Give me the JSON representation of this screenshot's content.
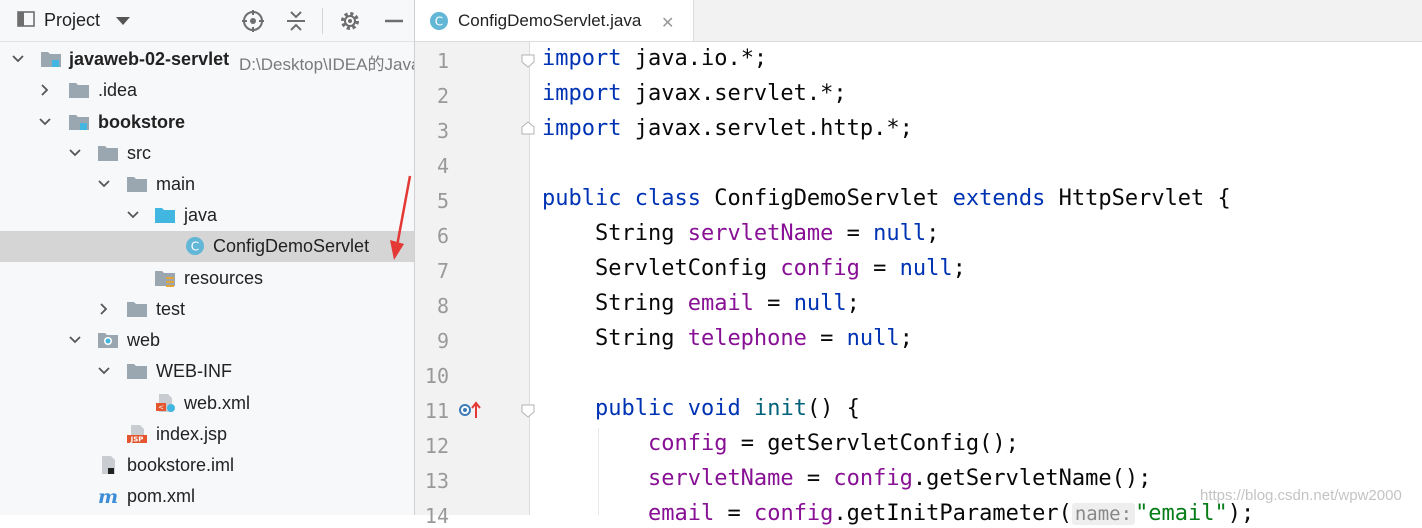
{
  "project_panel": {
    "title": "Project",
    "tree": [
      {
        "label": "javaweb-02-servlet",
        "path": "D:\\Desktop\\IDEA的Java",
        "bold": true
      },
      {
        "label": ".idea"
      },
      {
        "label": "bookstore",
        "bold": true
      },
      {
        "label": "src"
      },
      {
        "label": "main"
      },
      {
        "label": "java"
      },
      {
        "label": "ConfigDemoServlet"
      },
      {
        "label": "resources"
      },
      {
        "label": "test"
      },
      {
        "label": "web"
      },
      {
        "label": "WEB-INF"
      },
      {
        "label": "web.xml"
      },
      {
        "label": "index.jsp"
      },
      {
        "label": "bookstore.iml"
      },
      {
        "label": "pom.xml"
      }
    ]
  },
  "editor": {
    "tab_label": "ConfigDemoServlet.java",
    "line_numbers": [
      "1",
      "2",
      "3",
      "4",
      "5",
      "6",
      "7",
      "8",
      "9",
      "10",
      "11",
      "12",
      "13",
      "14"
    ],
    "code": {
      "l1_kw": "import",
      "l1_rest": " java.io.*;",
      "l2_kw": "import",
      "l2_rest": " javax.servlet.*;",
      "l3_kw": "import",
      "l3_rest": " javax.servlet.http.*;",
      "l5_kw1": "public",
      "l5_kw2": "class",
      "l5_cls": "ConfigDemoServlet",
      "l5_kw3": "extends",
      "l5_rest": " HttpServlet {",
      "l6_type": "    String ",
      "l6_fld": "servletName",
      "l6_eq": " = ",
      "l6_kw": "null",
      "l6_end": ";",
      "l7_type": "    ServletConfig ",
      "l7_fld": "config",
      "l7_eq": " = ",
      "l7_kw": "null",
      "l7_end": ";",
      "l8_type": "    String ",
      "l8_fld": "email",
      "l8_eq": " = ",
      "l8_kw": "null",
      "l8_end": ";",
      "l9_type": "    String ",
      "l9_fld": "telephone",
      "l9_eq": " = ",
      "l9_kw": "null",
      "l9_end": ";",
      "l11_kw1": "public",
      "l11_kw2": "void",
      "l11_mth": "init",
      "l11_rest": "() {",
      "l12_fld": "config",
      "l12_rest": " = getServletConfig();",
      "l13_fld1": "servletName",
      "l13_mid": " = ",
      "l13_fld2": "config",
      "l13_rest": ".getServletName();",
      "l14_fld1": "email",
      "l14_mid": " = ",
      "l14_fld2": "config",
      "l14_rest": ".getInitParameter(",
      "l14_hint": "name:",
      "l14_str": "\"email\"",
      "l14_end": ");"
    }
  },
  "watermark": "https://blog.csdn.net/wpw2000",
  "colors": {
    "keyword": "#0033b3",
    "field": "#871094",
    "method": "#00627a",
    "string": "#067d17",
    "selection": "#d5d5d5",
    "annotation_arrow": "#e53935"
  }
}
